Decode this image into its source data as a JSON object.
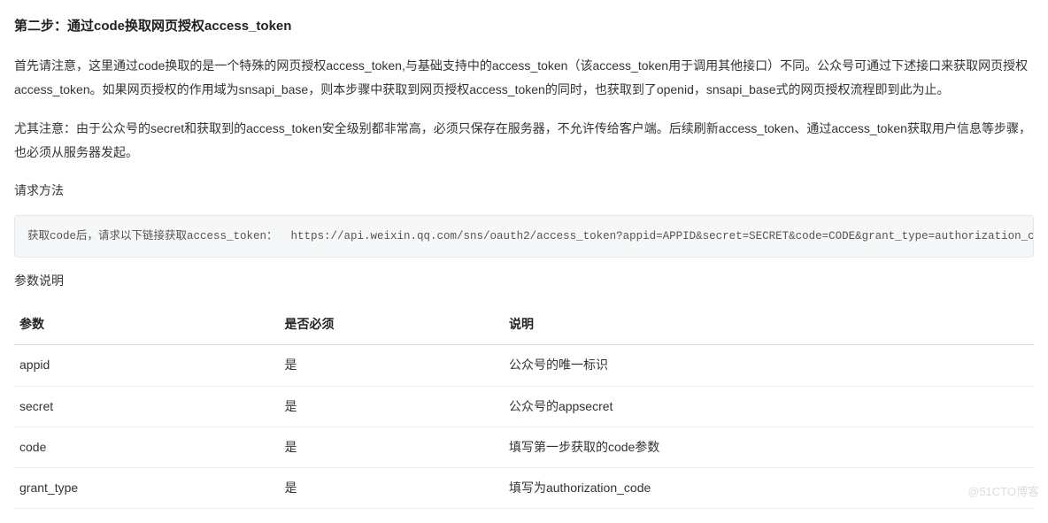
{
  "heading": "第二步：通过code换取网页授权access_token",
  "paragraph1": "首先请注意，这里通过code换取的是一个特殊的网页授权access_token,与基础支持中的access_token（该access_token用于调用其他接口）不同。公众号可通过下述接口来获取网页授权access_token。如果网页授权的作用域为snsapi_base，则本步骤中获取到网页授权access_token的同时，也获取到了openid，snsapi_base式的网页授权流程即到此为止。",
  "paragraph2": "尤其注意：由于公众号的secret和获取到的access_token安全级别都非常高，必须只保存在服务器，不允许传给客户端。后续刷新access_token、通过access_token获取用户信息等步骤，也必须从服务器发起。",
  "request_method_label": "请求方法",
  "code_block": "获取code后，请求以下链接获取access_token：  https://api.weixin.qq.com/sns/oauth2/access_token?appid=APPID&secret=SECRET&code=CODE&grant_type=authorization_code",
  "params_label": "参数说明",
  "table": {
    "headers": {
      "param": "参数",
      "required": "是否必须",
      "desc": "说明"
    },
    "rows": [
      {
        "param": "appid",
        "required": "是",
        "desc": "公众号的唯一标识"
      },
      {
        "param": "secret",
        "required": "是",
        "desc": "公众号的appsecret"
      },
      {
        "param": "code",
        "required": "是",
        "desc": "填写第一步获取的code参数"
      },
      {
        "param": "grant_type",
        "required": "是",
        "desc": "填写为authorization_code"
      }
    ]
  },
  "watermark": "@51CTO博客"
}
